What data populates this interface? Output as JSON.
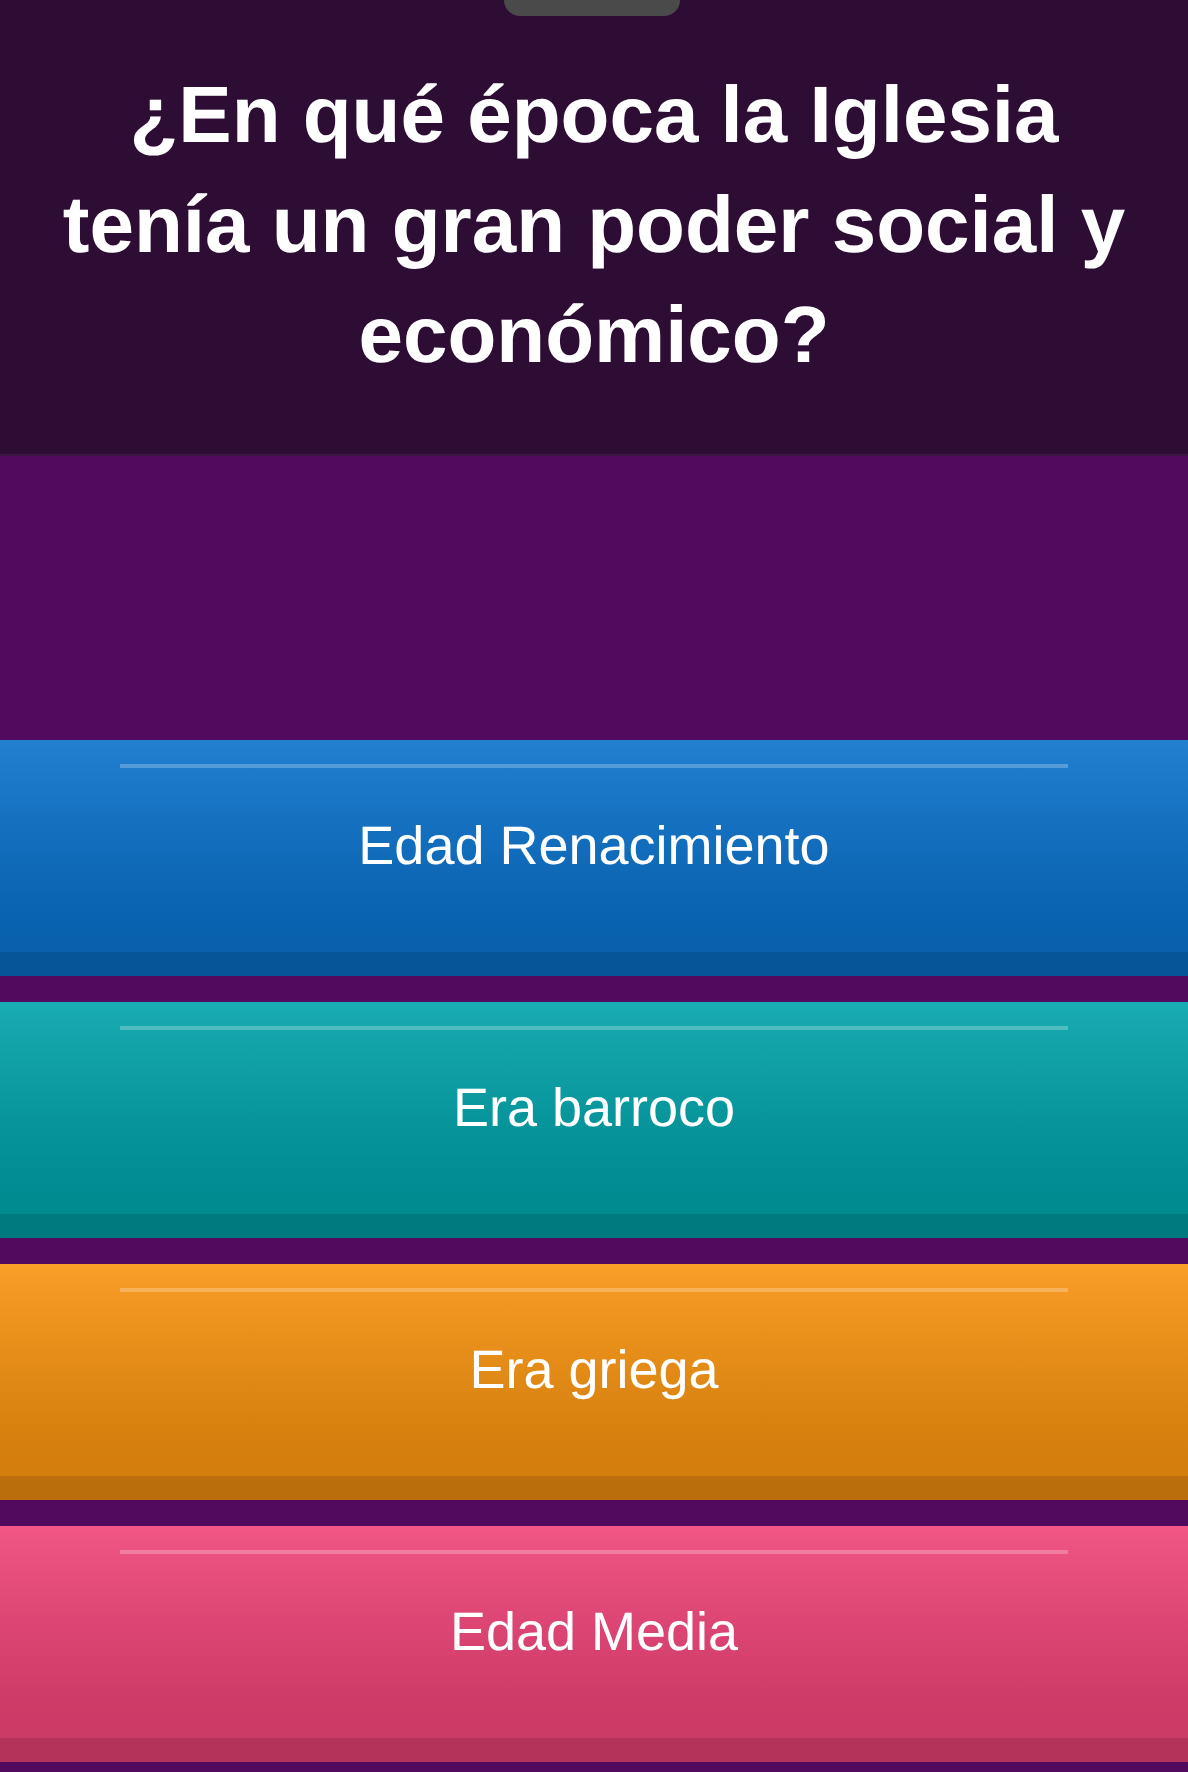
{
  "question": "¿En qué época la Iglesia tenía un gran poder social y económico?",
  "options": [
    {
      "label": "Edad Renacimiento",
      "color": "#0a72cc"
    },
    {
      "label": "Era barroco",
      "color": "#00a3aa"
    },
    {
      "label": "Era griega",
      "color": "#f99410"
    },
    {
      "label": "Edad Media",
      "color": "#f04478"
    }
  ]
}
